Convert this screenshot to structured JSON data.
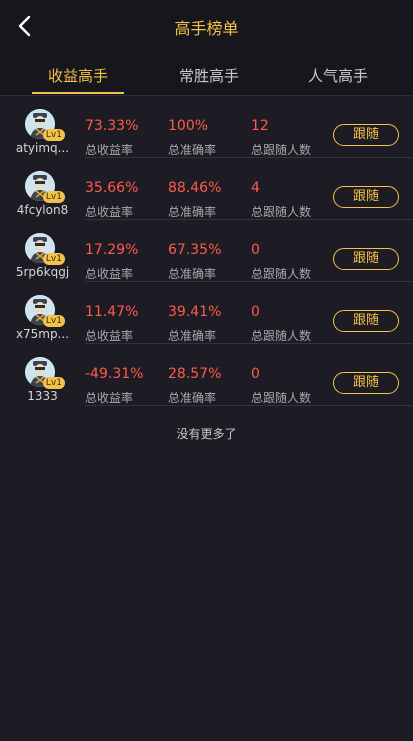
{
  "header": {
    "title": "高手榜单"
  },
  "tabs": [
    {
      "label": "收益高手",
      "active": true
    },
    {
      "label": "常胜高手",
      "active": false
    },
    {
      "label": "人气高手",
      "active": false
    }
  ],
  "stat_labels": {
    "profit": "总收益率",
    "accuracy": "总准确率",
    "followers": "总跟随人数"
  },
  "follow_label": "跟随",
  "level_badge": "Lv1",
  "rows": [
    {
      "name": "atyimq...",
      "profit": "73.33%",
      "accuracy": "100%",
      "followers": "12"
    },
    {
      "name": "4fcylon8",
      "profit": "35.66%",
      "accuracy": "88.46%",
      "followers": "4"
    },
    {
      "name": "5rp6kqgj",
      "profit": "17.29%",
      "accuracy": "67.35%",
      "followers": "0"
    },
    {
      "name": "x75mp...",
      "profit": "11.47%",
      "accuracy": "39.41%",
      "followers": "0"
    },
    {
      "name": "1333",
      "profit": "-49.31%",
      "accuracy": "28.57%",
      "followers": "0"
    }
  ],
  "footer_text": "没有更多了",
  "colors": {
    "accent": "#f3c24a",
    "value": "#ff5a4d",
    "background": "#1d1b24"
  },
  "icons": {
    "back": "chevron-left-icon",
    "avatar": "user-avatar-icon"
  }
}
